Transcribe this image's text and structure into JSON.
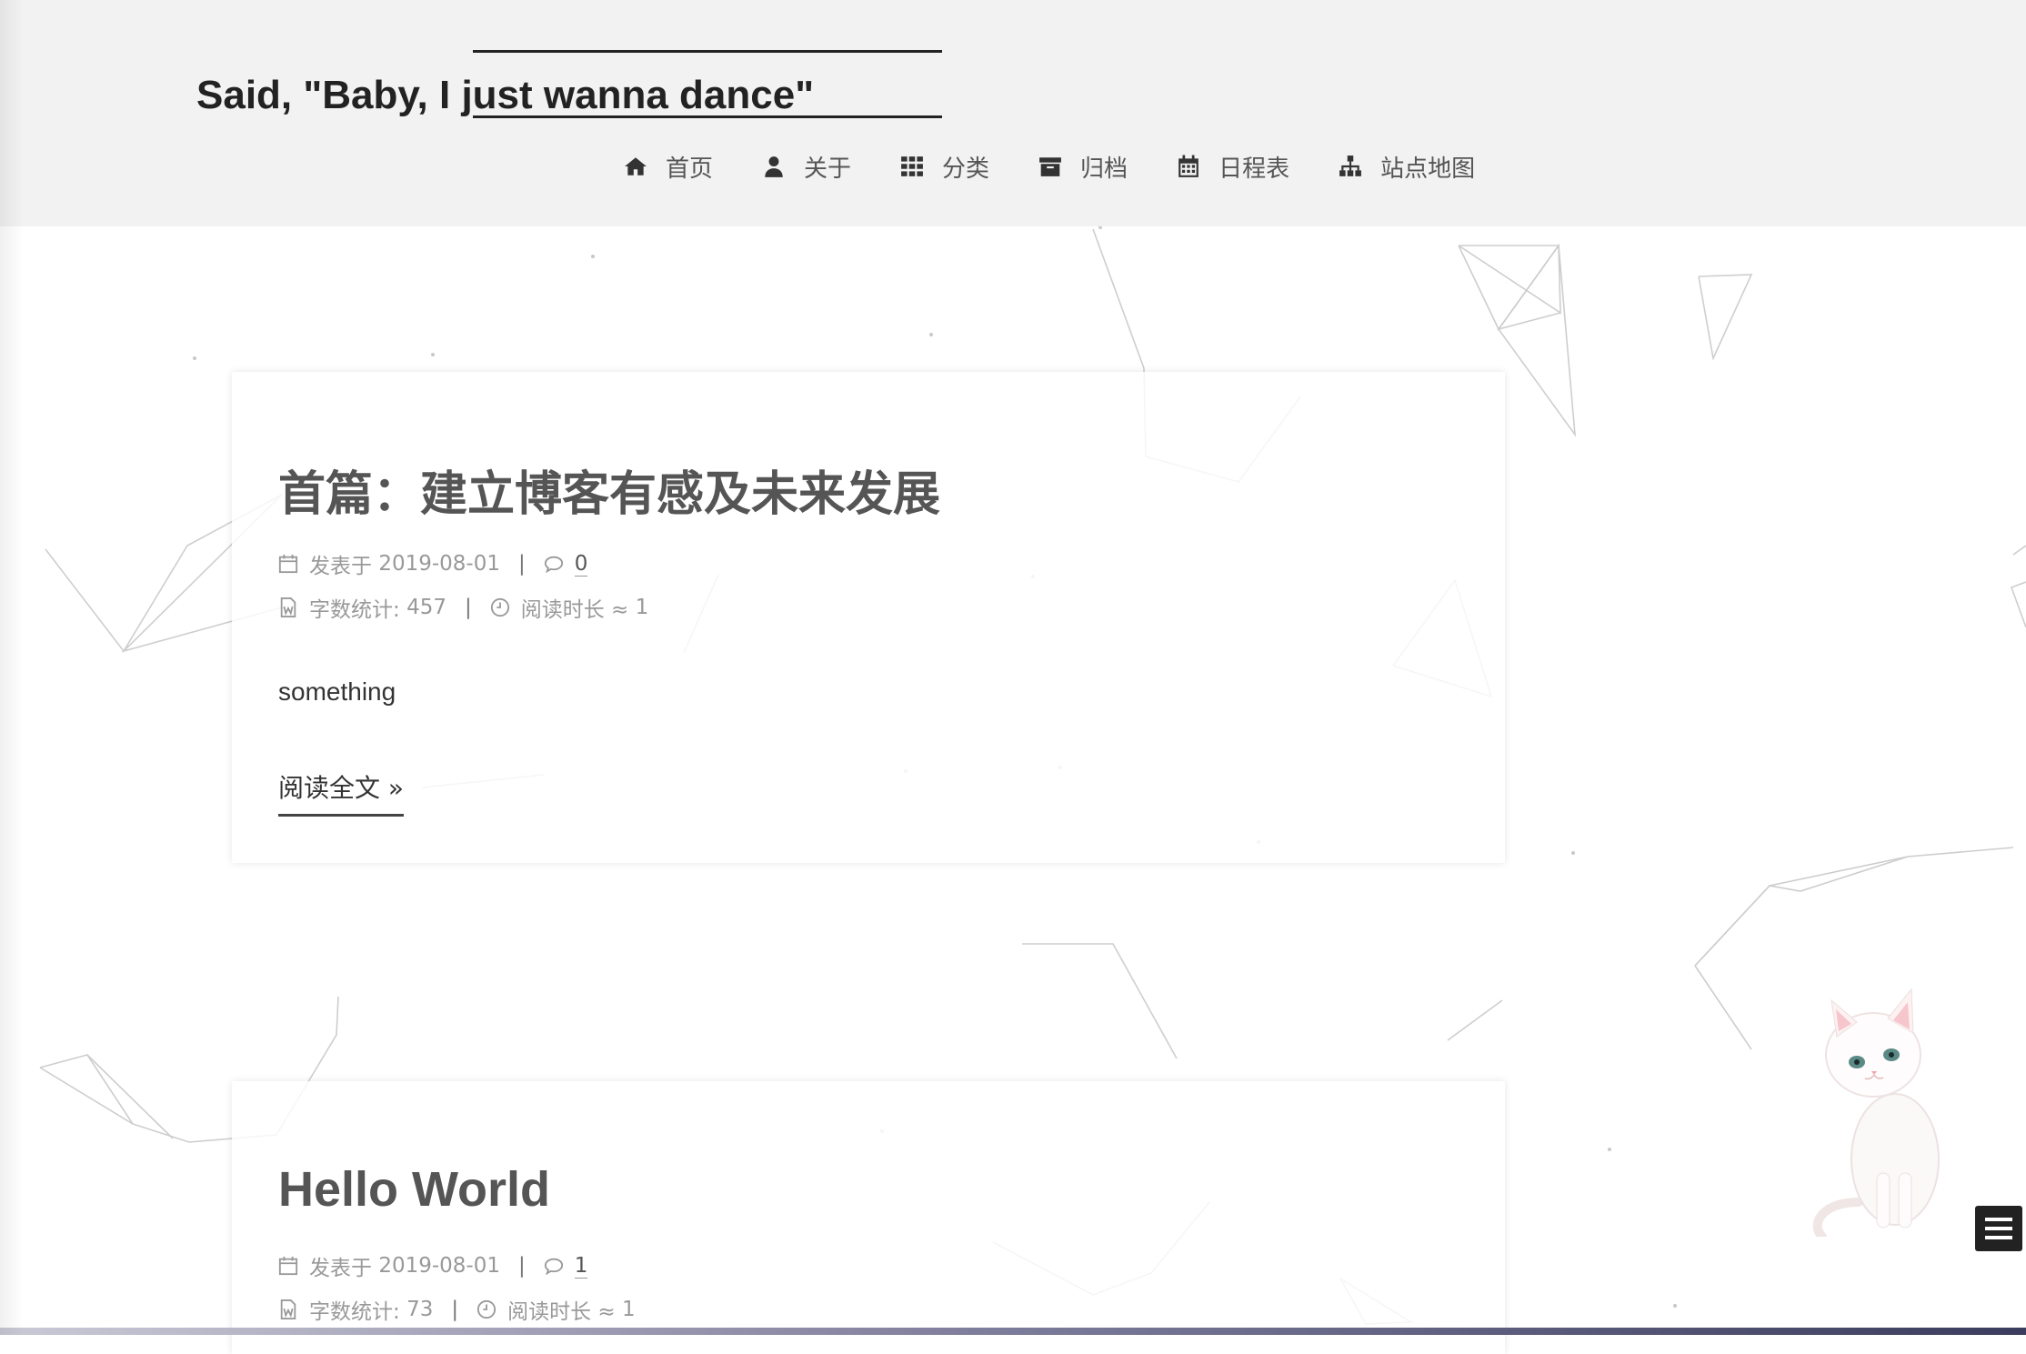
{
  "site": {
    "title": "Said, \"Baby, I just wanna dance\""
  },
  "nav": {
    "items": [
      {
        "label": "首页",
        "icon": "home-icon"
      },
      {
        "label": "关于",
        "icon": "user-icon"
      },
      {
        "label": "分类",
        "icon": "grid-icon"
      },
      {
        "label": "归档",
        "icon": "archive-icon"
      },
      {
        "label": "日程表",
        "icon": "calendar-icon"
      },
      {
        "label": "站点地图",
        "icon": "sitemap-icon"
      }
    ]
  },
  "posts": [
    {
      "title": "首篇：建立博客有感及未来发展",
      "published_label": "发表于",
      "date": "2019-08-01",
      "comments": "0",
      "wordcount_label": "字数统计:",
      "wordcount": "457",
      "readtime_label": "阅读时长 ≈",
      "readtime": "1",
      "excerpt": "something",
      "read_more": "阅读全文 »"
    },
    {
      "title": "Hello World",
      "published_label": "发表于",
      "date": "2019-08-01",
      "comments": "1",
      "wordcount_label": "字数统计:",
      "wordcount": "73",
      "readtime_label": "阅读时长 ≈",
      "readtime": "1"
    }
  ],
  "colors": {
    "header_bg": "#f2f2f2",
    "text": "#555555",
    "meta": "#999999",
    "accent": "#222222"
  }
}
